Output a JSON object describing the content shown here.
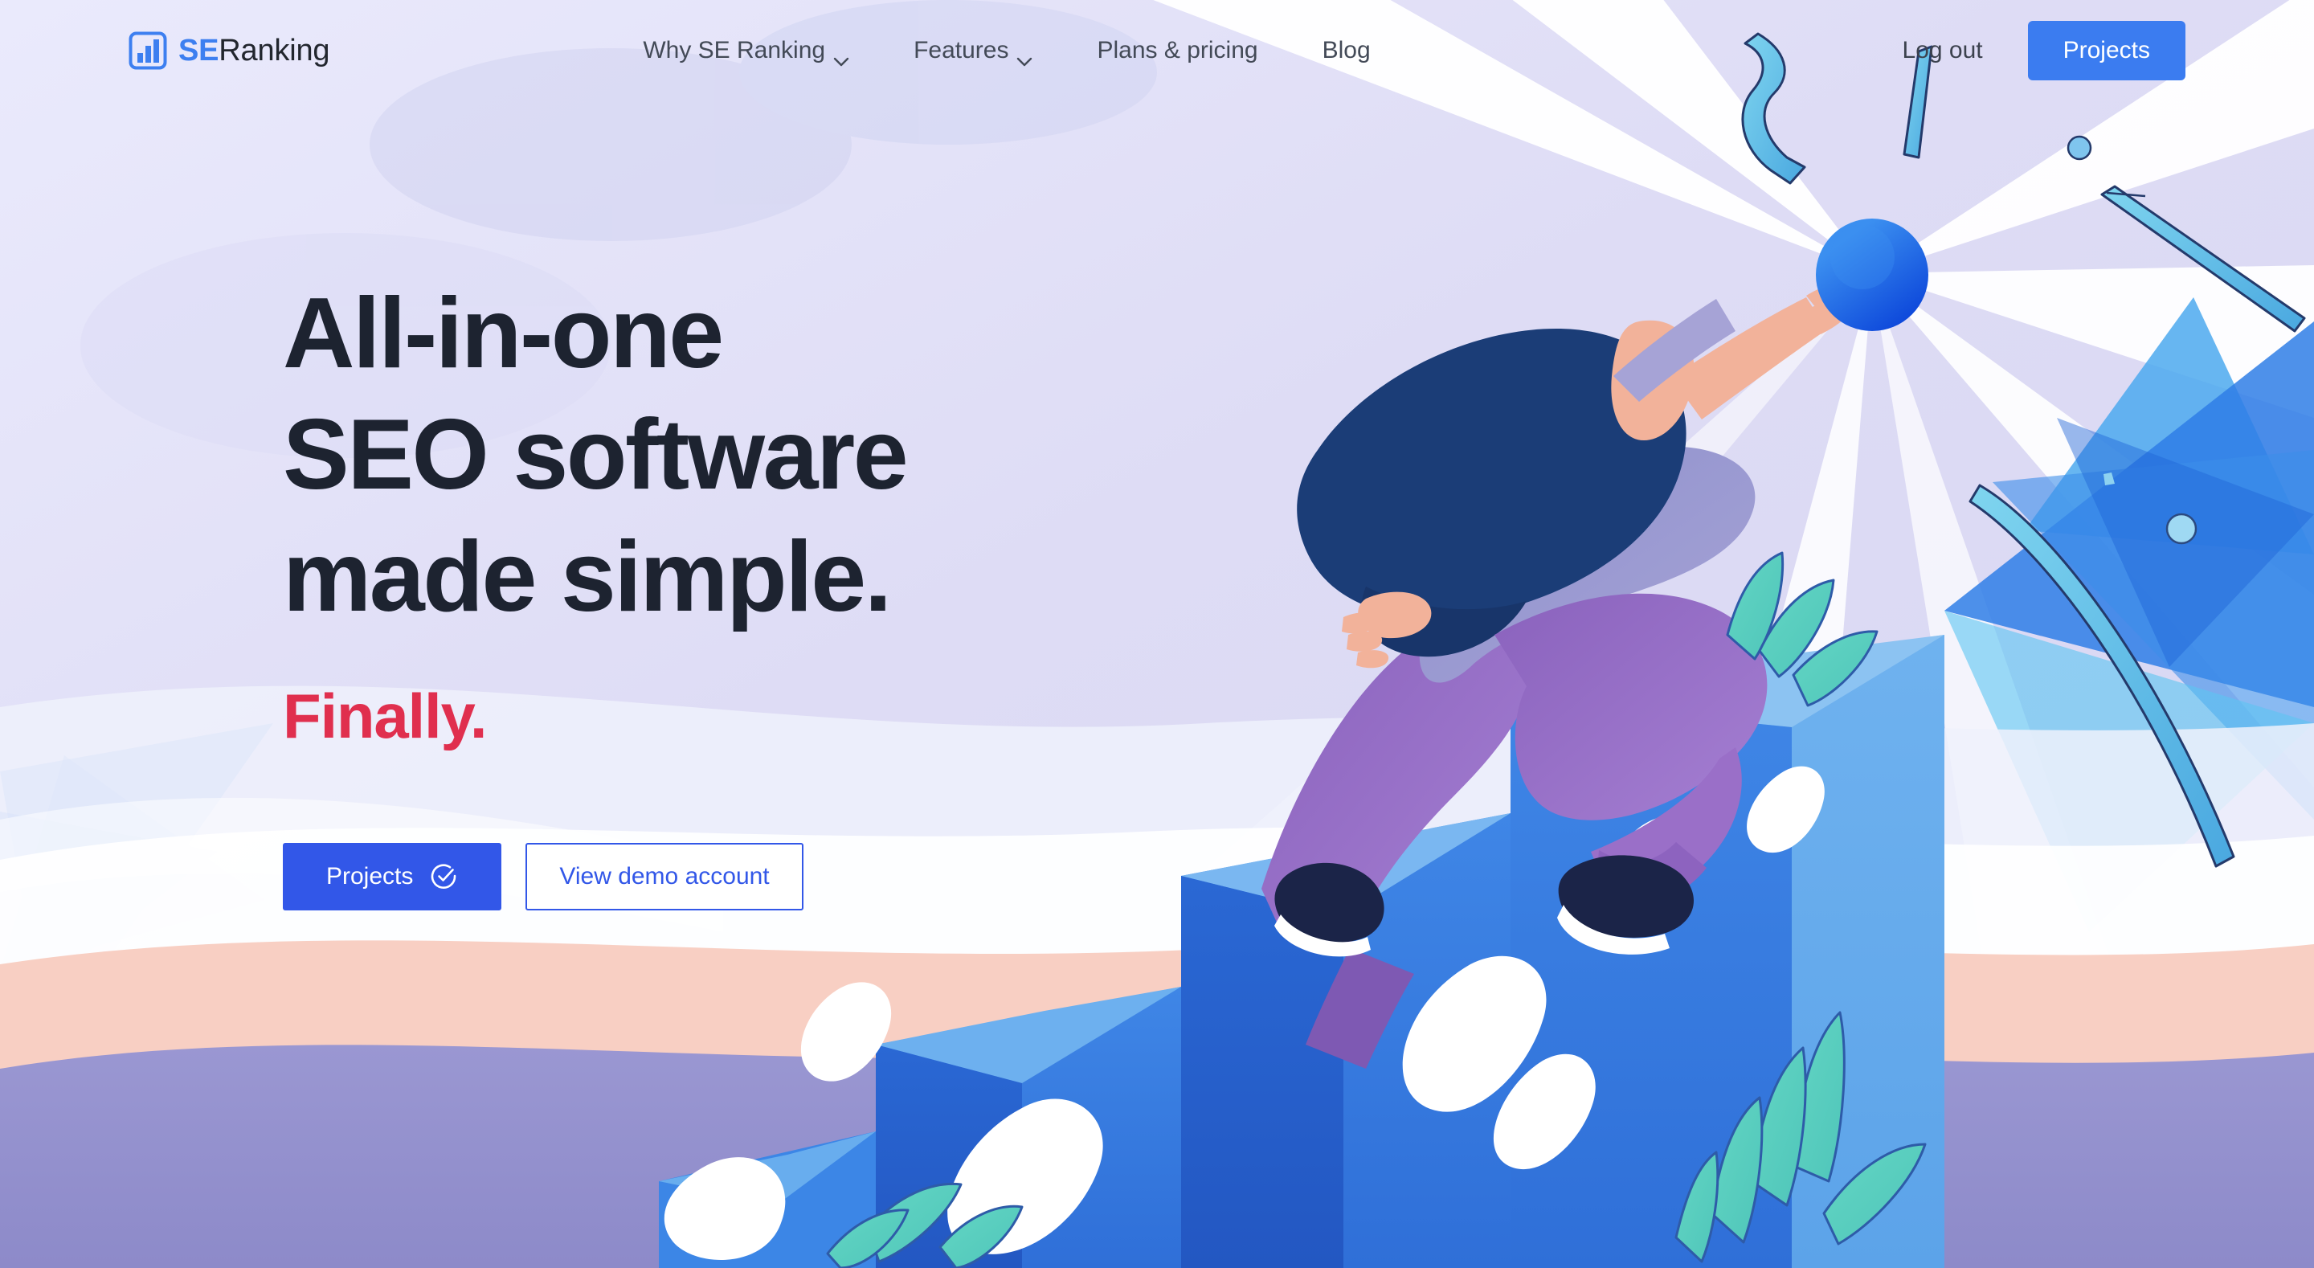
{
  "brand": {
    "logo_icon": "bar-chart-icon",
    "name_accent": "SE",
    "name_rest": "Ranking"
  },
  "header": {
    "nav_items": [
      {
        "label": "Why SE Ranking",
        "has_dropdown": true,
        "icon": "chevron-down-icon"
      },
      {
        "label": "Features",
        "has_dropdown": true,
        "icon": "chevron-down-icon"
      },
      {
        "label": "Plans & pricing",
        "has_dropdown": false,
        "icon": ""
      },
      {
        "label": "Blog",
        "has_dropdown": false,
        "icon": ""
      }
    ],
    "logout_label": "Log out",
    "projects_button_label": "Projects"
  },
  "hero": {
    "headline": "All-in-one\nSEO software\nmade simple.",
    "subheadline": "Finally.",
    "primary_cta": {
      "label": "Projects",
      "icon": "check-circle-icon"
    },
    "secondary_cta": {
      "label": "View demo account"
    }
  },
  "colors": {
    "brand_blue": "#3d7ff0",
    "header_button_blue": "#3b7cf0",
    "cta_blue": "#3257e8",
    "accent_red": "#e02f4e",
    "headline_dark": "#1d2330",
    "nav_text": "#434a57",
    "page_background": "#e3e3f7"
  }
}
